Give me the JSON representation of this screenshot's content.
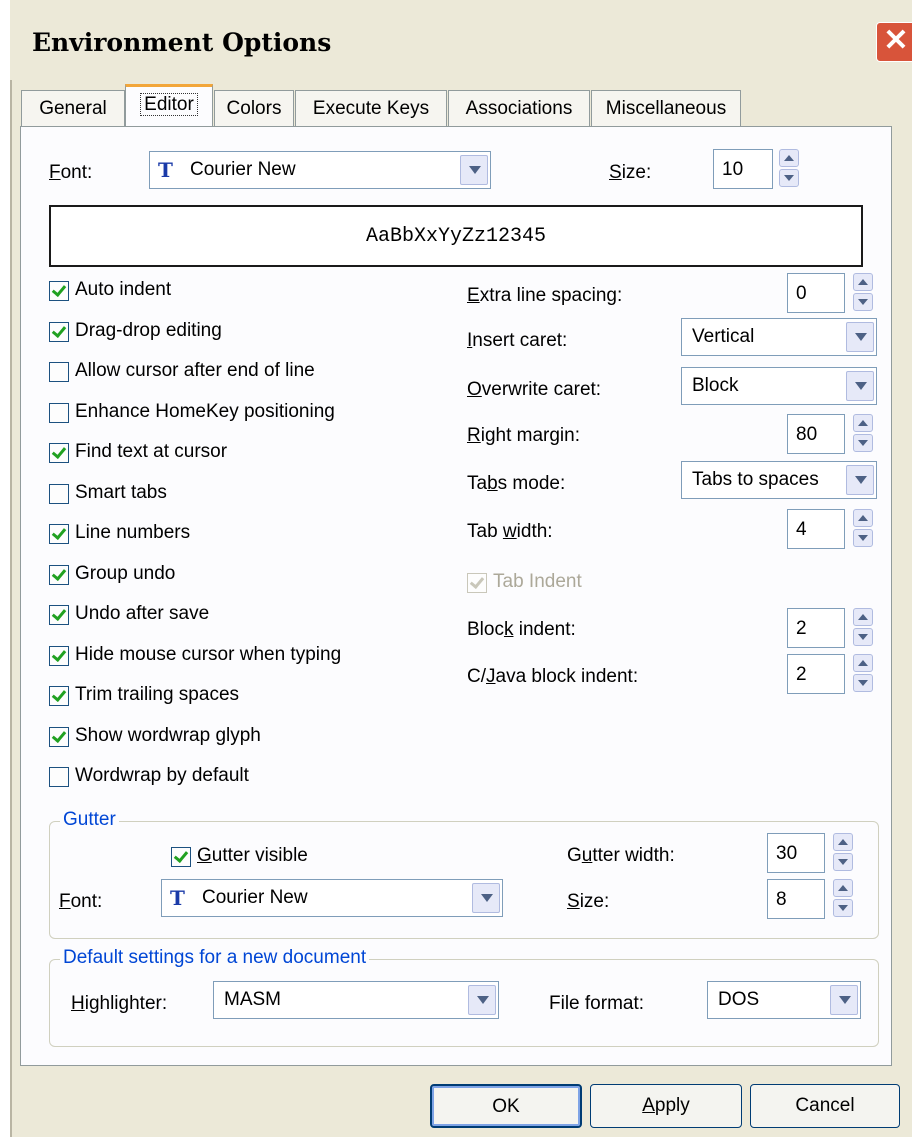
{
  "window": {
    "title": "Environment Options"
  },
  "tabs": [
    "General",
    "Editor",
    "Colors",
    "Execute Keys",
    "Associations",
    "Miscellaneous"
  ],
  "editor": {
    "font_label": "Font:",
    "font_value": "Courier New",
    "size_label": "Size:",
    "size_value": "10",
    "preview_text": "AaBbXxYyZz12345",
    "options": [
      {
        "label": "Auto indent",
        "checked": true
      },
      {
        "label": "Drag-drop editing",
        "checked": true
      },
      {
        "label": "Allow cursor after end of line",
        "checked": false
      },
      {
        "label": "Enhance HomeKey positioning",
        "checked": false
      },
      {
        "label": "Find text at cursor",
        "checked": true
      },
      {
        "label": "Smart tabs",
        "checked": false
      },
      {
        "label": "Line numbers",
        "checked": true
      },
      {
        "label": "Group undo",
        "checked": true
      },
      {
        "label": "Undo after save",
        "checked": true
      },
      {
        "label": "Hide mouse cursor when typing",
        "checked": true
      },
      {
        "label": "Trim trailing spaces",
        "checked": true
      },
      {
        "label": "Show wordwrap glyph",
        "checked": true
      },
      {
        "label": "Wordwrap by default",
        "checked": false
      }
    ],
    "extra_line_spacing_label": "Extra line spacing:",
    "extra_line_spacing_value": "0",
    "insert_caret_label": "Insert caret:",
    "insert_caret_value": "Vertical",
    "overwrite_caret_label": "Overwrite caret:",
    "overwrite_caret_value": "Block",
    "right_margin_label": "Right margin:",
    "right_margin_value": "80",
    "tabs_mode_label": "Tabs mode:",
    "tabs_mode_value": "Tabs to spaces",
    "tab_width_label": "Tab width:",
    "tab_width_value": "4",
    "tab_indent_label": "Tab Indent",
    "tab_indent_checked": true,
    "block_indent_label": "Block indent:",
    "block_indent_value": "2",
    "cjava_block_indent_label": "C/Java block indent:",
    "cjava_block_indent_value": "2"
  },
  "gutter": {
    "caption": "Gutter",
    "visible_label": "Gutter visible",
    "visible_checked": true,
    "width_label": "Gutter width:",
    "width_value": "30",
    "font_label": "Font:",
    "font_value": "Courier New",
    "size_label": "Size:",
    "size_value": "8"
  },
  "defaults": {
    "caption": "Default settings for a new document",
    "highlighter_label": "Highlighter:",
    "highlighter_value": "MASM",
    "file_format_label": "File format:",
    "file_format_value": "DOS"
  },
  "buttons": {
    "ok": "OK",
    "apply": "Apply",
    "cancel": "Cancel"
  },
  "colors": {
    "tab_highlight": "#f2a63a",
    "group_caption": "#0046d5",
    "close_button": "#d8543a",
    "check_mark": "#21a121"
  }
}
